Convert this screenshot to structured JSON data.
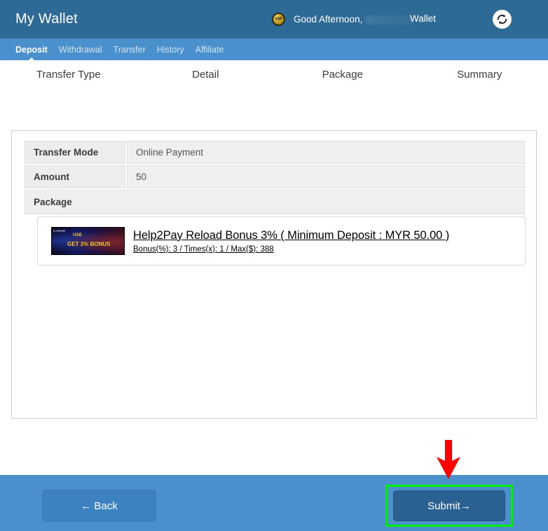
{
  "header": {
    "brand": "My Wallet",
    "vip_badge": "VIP",
    "greeting": "Good Afternoon,",
    "wallet_label": "Wallet",
    "refresh_icon": "refresh-icon",
    "bg_color": "#2e6a96"
  },
  "nav": {
    "tabs": [
      {
        "label": "Deposit",
        "active": true
      },
      {
        "label": "Withdrawal",
        "active": false
      },
      {
        "label": "Transfer",
        "active": false
      },
      {
        "label": "History",
        "active": false
      },
      {
        "label": "Affiliate",
        "active": false
      }
    ],
    "bg_color": "#4a90cd"
  },
  "stepper": {
    "steps": [
      {
        "label": "Transfer Type",
        "completed": true
      },
      {
        "label": "Detail",
        "completed": true
      },
      {
        "label": "Package",
        "completed": true
      },
      {
        "label": "Summary",
        "completed": true
      }
    ],
    "track_color": "#19c0d8",
    "dot_center_color": "#0e4050"
  },
  "summary": {
    "rows": [
      {
        "label": "Transfer Mode",
        "value": "Online Payment"
      },
      {
        "label": "Amount",
        "value": "50"
      }
    ],
    "package_header": "Package",
    "package": {
      "title": "Help2Pay Reload Bonus 3% ( Minimum Deposit : MYR 50.00 )",
      "details": "Bonus(%): 3 / Times(x): 1 / Max($): 388",
      "banner_line1": "USE",
      "banner_line2": "GET 3% BONUS",
      "banner_logo": "CASINO"
    }
  },
  "footer": {
    "back_label": "← Back",
    "submit_label": "Submit→",
    "highlight_color": "#00f000",
    "arrow_color": "#ff0000"
  }
}
